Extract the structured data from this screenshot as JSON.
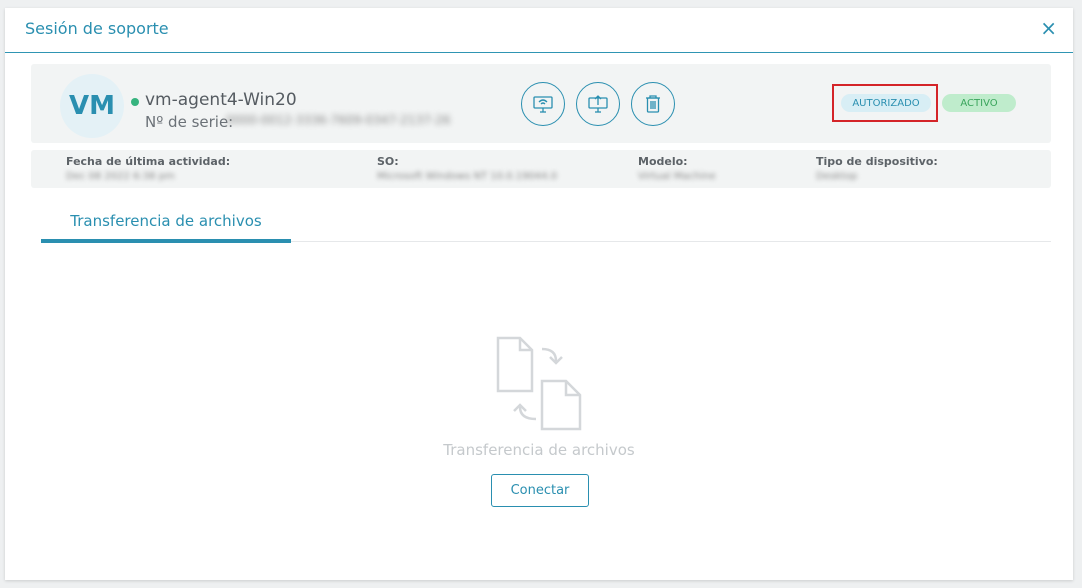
{
  "modal": {
    "title": "Sesión de soporte",
    "close_label": "×"
  },
  "device": {
    "avatar": "VM",
    "status_color": "#36b37e",
    "name": "vm-agent4-Win20",
    "serial_label": "Nº de serie:",
    "serial_value": "0000-0012-3336-7609-0347-2137-26",
    "actions": [
      {
        "icon": "remote-desktop-icon"
      },
      {
        "icon": "remote-upload-icon"
      },
      {
        "icon": "trash-icon"
      }
    ],
    "badges": {
      "authorized": "AUTORIZADO",
      "active": "ACTIVO"
    }
  },
  "info": [
    {
      "label": "Fecha de última actividad:",
      "value": "Dec 08 2022 6:38 pm"
    },
    {
      "label": "SO:",
      "value": "Microsoft Windows NT 10.0.19044.0"
    },
    {
      "label": "Modelo:",
      "value": "Virtual Machine"
    },
    {
      "label": "Tipo de dispositivo:",
      "value": "Desktop"
    }
  ],
  "tabs": [
    {
      "label": "Transferencia de archivos",
      "active": true
    }
  ],
  "empty_state": {
    "icon": "file-transfer-icon",
    "text": "Transferencia de archivos",
    "button": "Conectar"
  },
  "colors": {
    "accent": "#2a8fb0",
    "highlight": "#d42428",
    "active_badge": "#bfeccc",
    "authorized_badge": "#d8eef5"
  }
}
